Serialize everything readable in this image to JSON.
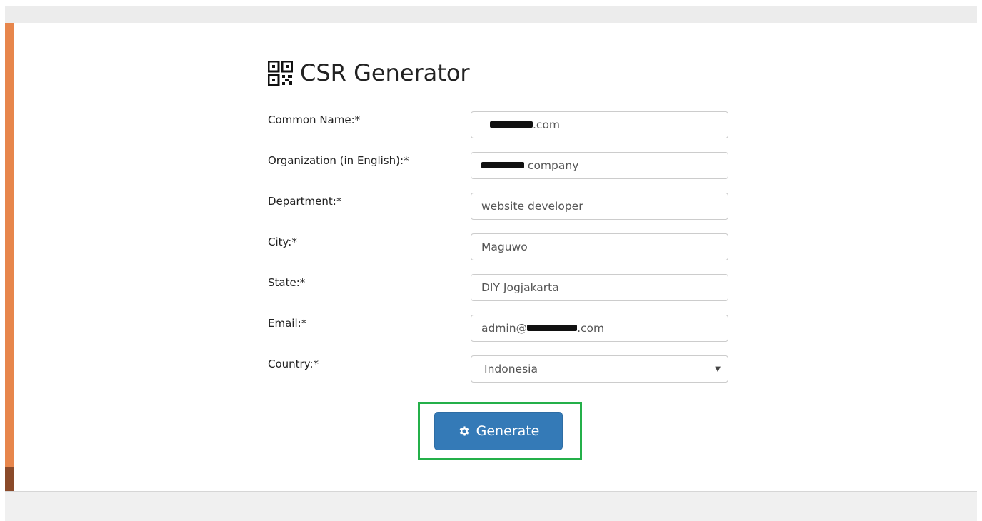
{
  "page": {
    "title": "CSR Generator",
    "title_icon": "qr-code-icon"
  },
  "form": {
    "common_name": {
      "label": "Common Name:*",
      "value_suffix": ".com"
    },
    "organization": {
      "label": "Organization (in English):*",
      "value_suffix": " company"
    },
    "department": {
      "label": "Department:*",
      "value": "website developer"
    },
    "city": {
      "label": "City:*",
      "value": "Maguwo"
    },
    "state": {
      "label": "State:*",
      "value": "DIY Jogjakarta"
    },
    "email": {
      "label": "Email:*",
      "value_prefix": "admin@",
      "value_suffix": ".com"
    },
    "country": {
      "label": "Country:*",
      "selected": "Indonesia",
      "caret_icon": "caret-down-icon"
    }
  },
  "actions": {
    "generate_label": "Generate",
    "generate_icon": "gear-icon",
    "highlight_color": "#24b04a",
    "button_color": "#347ab7"
  },
  "colors": {
    "side_accent": "#e7864c"
  }
}
